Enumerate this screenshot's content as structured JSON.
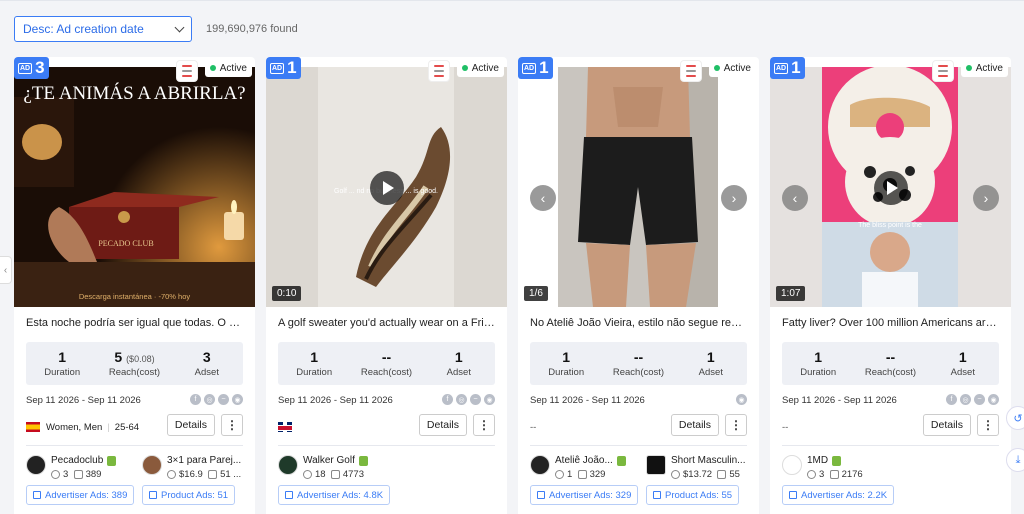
{
  "toolbar": {
    "sort_label": "Desc: Ad creation date",
    "found_text": "199,690,976 found"
  },
  "stat_labels": {
    "duration": "Duration",
    "reach": "Reach(cost)",
    "adset": "Adset"
  },
  "buttons": {
    "details": "Details",
    "more": "⋮"
  },
  "status_text": "Active",
  "cards": [
    {
      "ad_count": "3",
      "title": "Esta noche podría ser igual que todas. O po...",
      "media": {
        "headline": "¿TE ANIMÁS A ABRIRLA?",
        "box_text": "PECADO CLUB",
        "caption": "Descarga instantánea · -70% hoy"
      },
      "stats": {
        "duration": "1",
        "reach": "5",
        "reach_cost": "($0.08)",
        "adset": "3"
      },
      "dates": "Sep 11 2026 - Sep 11 2026",
      "audience": {
        "gender": "Women, Men",
        "age": "25-64"
      },
      "advertisers": [
        {
          "name": "Pecadoclub",
          "m1": "3",
          "m2": "389"
        },
        {
          "name": "3×1 para Parej...",
          "m1": "$16.9",
          "m2": "51 ..."
        }
      ],
      "links": [
        "Advertiser Ads: 389",
        "Product Ads: 51"
      ]
    },
    {
      "ad_count": "1",
      "title": "A golf sweater you'd actually wear on a Frid...",
      "media": {
        "duration": "0:10",
        "overlay_text": "Golf ... nd no business ... is good."
      },
      "stats": {
        "duration": "1",
        "reach": "--",
        "adset": "1"
      },
      "dates": "Sep 11 2026 - Sep 11 2026",
      "advertisers": [
        {
          "name": "Walker Golf",
          "m1": "18",
          "m2": "4773"
        }
      ],
      "links": [
        "Advertiser Ads: 4.8K"
      ]
    },
    {
      "ad_count": "1",
      "title": "No Ateliê João Vieira, estilo não segue regr...",
      "media": {
        "duration": "1/6"
      },
      "stats": {
        "duration": "1",
        "reach": "--",
        "adset": "1"
      },
      "dates": "Sep 11 2026 - Sep 11 2026",
      "audience_text": "--",
      "advertisers": [
        {
          "name": "Ateliê João...",
          "m1": "1",
          "m2": "329"
        },
        {
          "name": "Short Masculin...",
          "m1": "$13.72",
          "m2": "55"
        }
      ],
      "links": [
        "Advertiser Ads: 329",
        "Product Ads: 55"
      ]
    },
    {
      "ad_count": "1",
      "title": "Fatty liver? Over 100 million Americans are l...",
      "media": {
        "duration": "1:07",
        "overlay_text": "The bliss point is the"
      },
      "stats": {
        "duration": "1",
        "reach": "--",
        "adset": "1"
      },
      "dates": "Sep 11 2026 - Sep 11 2026",
      "audience_text": "--",
      "advertisers": [
        {
          "name": "1MD",
          "m1": "3",
          "m2": "2176"
        }
      ],
      "links": [
        "Advertiser Ads: 2.2K"
      ]
    }
  ],
  "colors": {
    "accent": "#3b7cf5",
    "active": "#1fbf66",
    "shopify": "#7ab83e"
  },
  "icons": [
    "chevron-down-icon",
    "ad-icon",
    "play-icon",
    "arrow-left-icon",
    "arrow-right-icon",
    "facebook-icon",
    "instagram-icon",
    "messenger-icon",
    "audience-network-icon",
    "shopify-icon",
    "more-icon"
  ]
}
